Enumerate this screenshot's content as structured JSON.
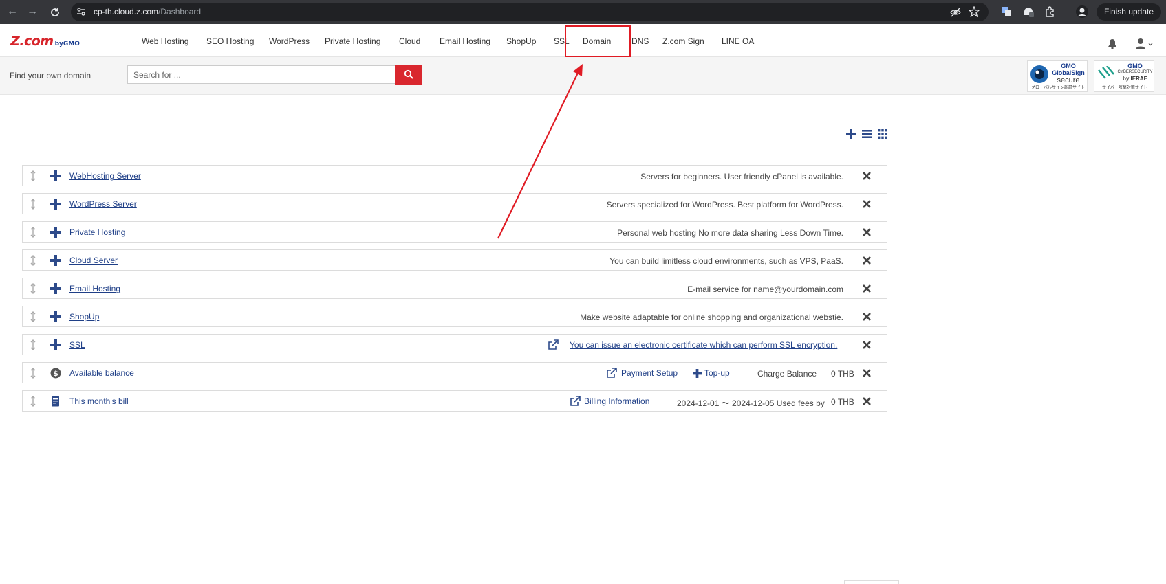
{
  "browser": {
    "url_host": "cp-th.cloud.z.com",
    "url_path": "/Dashboard",
    "finish_update_label": "Finish update"
  },
  "site": {
    "logo_text": "Z.com",
    "logo_sub": "byGMO",
    "nav": [
      "Web Hosting",
      "SEO Hosting",
      "WordPress",
      "Private Hosting",
      "Cloud",
      "Email Hosting",
      "ShopUp",
      "SSL",
      "Domain",
      "DNS",
      "Z.com Sign",
      "LINE OA"
    ],
    "highlighted_nav": "Domain",
    "accent_color": "#d9272e",
    "link_color": "#1f3f87"
  },
  "search": {
    "label": "Find your own domain",
    "placeholder": "Search for ..."
  },
  "badges": {
    "globalsign": {
      "line1": "GMO",
      "line2": "GlobalSign",
      "line3": "secure",
      "line4": "グローバルサイン認証サイト"
    },
    "cybersecurity": {
      "line1": "GMO",
      "line2": "CYBERSECURITY",
      "line3": "by IERAE",
      "line4": "サイバー攻撃対策サイト"
    }
  },
  "services": [
    {
      "title": "WebHosting Server",
      "icon": "plus-icon",
      "desc": "Servers for beginners. User friendly cPanel is available."
    },
    {
      "title": "WordPress Server",
      "icon": "plus-icon",
      "desc": "Servers specialized for WordPress. Best platform for WordPress."
    },
    {
      "title": "Private Hosting",
      "icon": "plus-icon",
      "desc": "Personal web hosting No more data sharing Less Down Time."
    },
    {
      "title": "Cloud Server",
      "icon": "plus-icon",
      "desc": "You can build limitless cloud environments, such as VPS, PaaS."
    },
    {
      "title": "Email Hosting",
      "icon": "plus-icon",
      "desc": "E-mail service for name@yourdomain.com"
    },
    {
      "title": "ShopUp",
      "icon": "plus-icon",
      "desc": "Make website adaptable for online shopping and organizational webstie."
    },
    {
      "title": "SSL",
      "icon": "plus-icon",
      "link": "You can issue an electronic certificate which can perform SSL encryption."
    }
  ],
  "balance": {
    "title": "Available balance",
    "icon": "dollar-coin-icon",
    "payment_setup": "Payment Setup",
    "topup": "Top-up",
    "charge_label": "Charge Balance",
    "charge_value": "0 THB"
  },
  "bill": {
    "title": "This month's bill",
    "icon": "document-icon",
    "billing_info": "Billing Information",
    "period": "2024-12-01 〜 2024-12-05 Used fees by",
    "value": "0 THB"
  },
  "annotation": {
    "box_color": "#e01b24",
    "arrow_color": "#e01b24"
  }
}
